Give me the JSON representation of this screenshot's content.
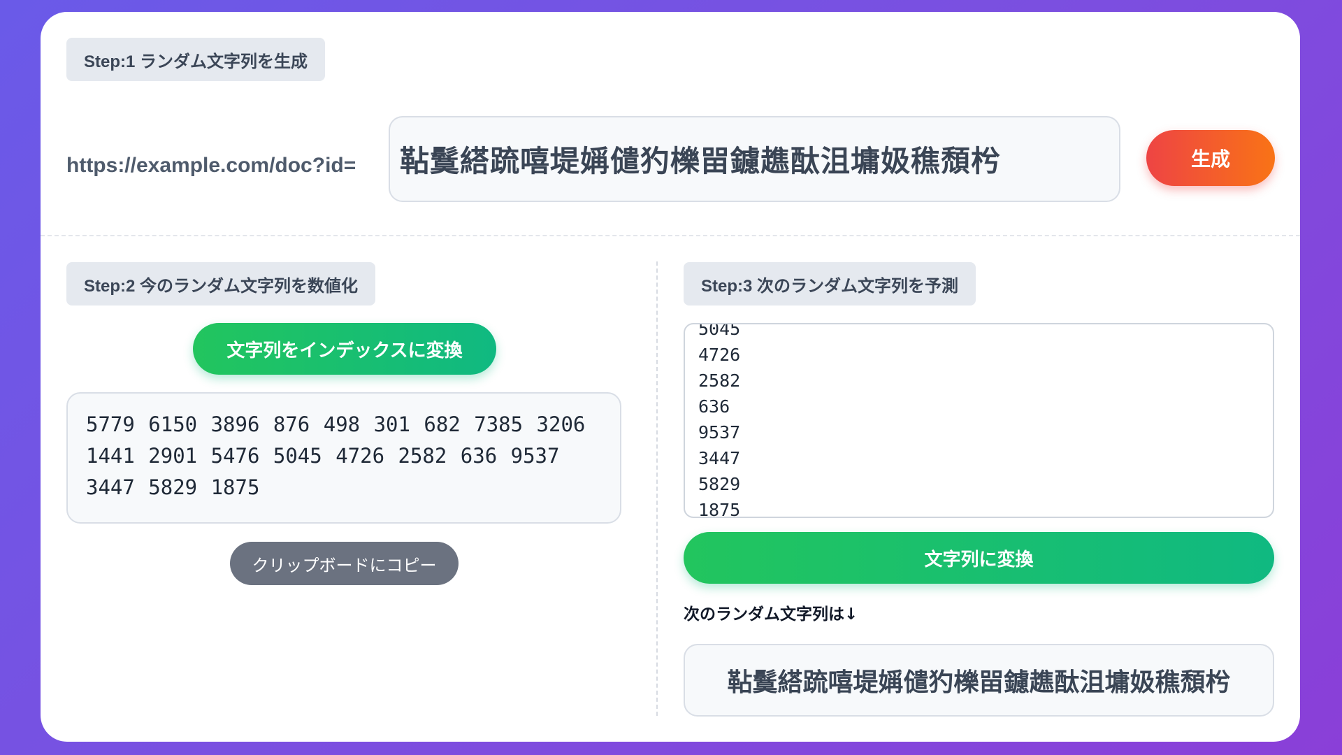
{
  "step1": {
    "label": "Step:1 ランダム文字列を生成",
    "url_prefix": "https://example.com/doc?id=",
    "random_string": "䩞鬕䌋䟽嘻堤㛵儙犳櫟㽞鑢趭酞沮墉㚫穛頹枍",
    "generate_button": "生成"
  },
  "step2": {
    "label": "Step:2 今のランダム文字列を数値化",
    "convert_button": "文字列をインデックスに変換",
    "indices_text": "5779 6150 3896 876 498 301 682 7385 3206 1441 2901 5476 5045 4726 2582 636 9537 3447 5829 1875",
    "copy_button": "クリップボードにコピー"
  },
  "step3": {
    "label": "Step:3 次のランダム文字列を予測",
    "predicted_indices": [
      "5045",
      "4726",
      "2582",
      "636",
      "9537",
      "3447",
      "5829",
      "1875"
    ],
    "to_string_button": "文字列に変換",
    "next_label": "次のランダム文字列は↓",
    "result_string": "䩞鬕䌋䟽嘻堤㛵儙犳櫟㽞鑢趭酞沮墉㚫穛頹枍"
  },
  "colors": {
    "generate_gradient": [
      "#ee4444",
      "#f97316"
    ],
    "green_gradient": [
      "#22c55e",
      "#10b981"
    ],
    "copy_button": "#6b7280",
    "background_gradient": [
      "#6a5ae8",
      "#8a3fd8"
    ]
  }
}
